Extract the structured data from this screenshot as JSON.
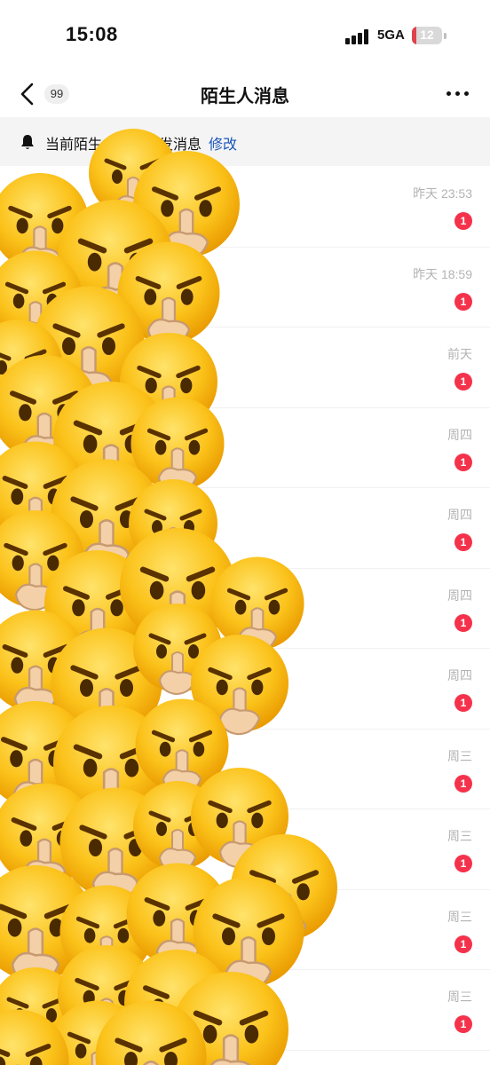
{
  "status_bar": {
    "time": "15:08",
    "network": "5GA",
    "battery_level": "12"
  },
  "nav": {
    "back_count": "99",
    "title": "陌生人消息"
  },
  "notice": {
    "text": "当前陌生人可给你发消息",
    "link": "修改"
  },
  "messages": [
    {
      "time": "昨天 23:53",
      "unread": "1"
    },
    {
      "time": "昨天 18:59",
      "unread": "1"
    },
    {
      "time": "前天",
      "unread": "1"
    },
    {
      "time": "周四",
      "unread": "1"
    },
    {
      "time": "周四",
      "unread": "1"
    },
    {
      "time": "周四",
      "unread": "1"
    },
    {
      "time": "周四",
      "unread": "1"
    },
    {
      "time": "周三",
      "unread": "1"
    },
    {
      "time": "周三",
      "unread": "1"
    },
    {
      "time": "周三",
      "unread": "1"
    },
    {
      "time": "周三",
      "unread": "1"
    }
  ],
  "overlay": {
    "icon": "shushing-angry-face-emoji",
    "color": "#f5b800"
  },
  "colors": {
    "unread_badge": "#f5324b",
    "link": "#1a56b8",
    "notice_bg": "#f4f4f5"
  }
}
